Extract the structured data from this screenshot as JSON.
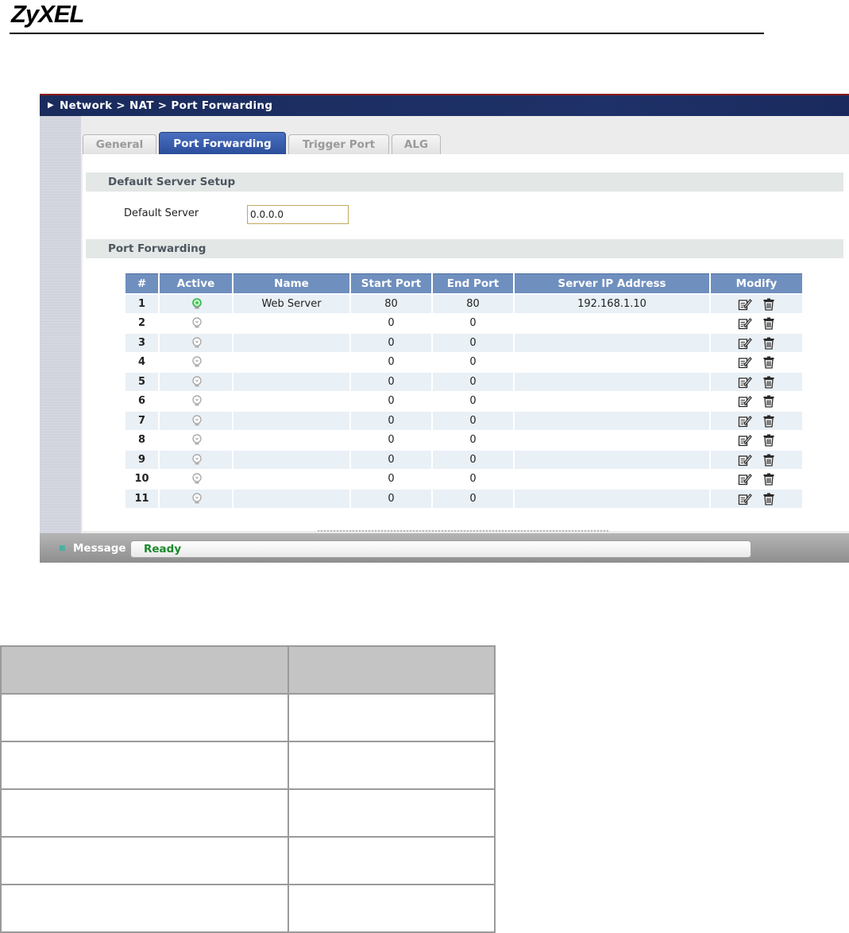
{
  "brand": {
    "logo_text": "ZyXEL"
  },
  "window": {
    "breadcrumb": "Network > NAT > Port Forwarding",
    "tabs": [
      {
        "label": "General",
        "active": false
      },
      {
        "label": "Port Forwarding",
        "active": true
      },
      {
        "label": "Trigger Port",
        "active": false
      },
      {
        "label": "ALG",
        "active": false
      }
    ],
    "default_server_section": {
      "title": "Default Server Setup",
      "field_label": "Default Server",
      "field_value": "0.0.0.0"
    },
    "port_forwarding_section": {
      "title": "Port Forwarding",
      "columns": [
        "#",
        "Active",
        "Name",
        "Start Port",
        "End Port",
        "Server IP Address",
        "Modify"
      ],
      "rows": [
        {
          "index": "1",
          "active": true,
          "name": "Web Server",
          "start_port": "80",
          "end_port": "80",
          "server_ip": "192.168.1.10"
        },
        {
          "index": "2",
          "active": false,
          "name": "",
          "start_port": "0",
          "end_port": "0",
          "server_ip": ""
        },
        {
          "index": "3",
          "active": false,
          "name": "",
          "start_port": "0",
          "end_port": "0",
          "server_ip": ""
        },
        {
          "index": "4",
          "active": false,
          "name": "",
          "start_port": "0",
          "end_port": "0",
          "server_ip": ""
        },
        {
          "index": "5",
          "active": false,
          "name": "",
          "start_port": "0",
          "end_port": "0",
          "server_ip": ""
        },
        {
          "index": "6",
          "active": false,
          "name": "",
          "start_port": "0",
          "end_port": "0",
          "server_ip": ""
        },
        {
          "index": "7",
          "active": false,
          "name": "",
          "start_port": "0",
          "end_port": "0",
          "server_ip": ""
        },
        {
          "index": "8",
          "active": false,
          "name": "",
          "start_port": "0",
          "end_port": "0",
          "server_ip": ""
        },
        {
          "index": "9",
          "active": false,
          "name": "",
          "start_port": "0",
          "end_port": "0",
          "server_ip": ""
        },
        {
          "index": "10",
          "active": false,
          "name": "",
          "start_port": "0",
          "end_port": "0",
          "server_ip": ""
        },
        {
          "index": "11",
          "active": false,
          "name": "",
          "start_port": "0",
          "end_port": "0",
          "server_ip": ""
        }
      ]
    },
    "status": {
      "label": "Message",
      "value": "Ready"
    },
    "icons": {
      "edit": "edit-icon",
      "delete": "trash-icon",
      "active": "lightbulb-on-icon",
      "inactive": "lightbulb-off-icon"
    },
    "colors": {
      "title_bar": "#1e3168",
      "table_header": "#6f8fbe",
      "active_tab": "#2b4d9a",
      "status_ready": "#1a8a2a",
      "active_bulb": "#2fb84a"
    }
  }
}
